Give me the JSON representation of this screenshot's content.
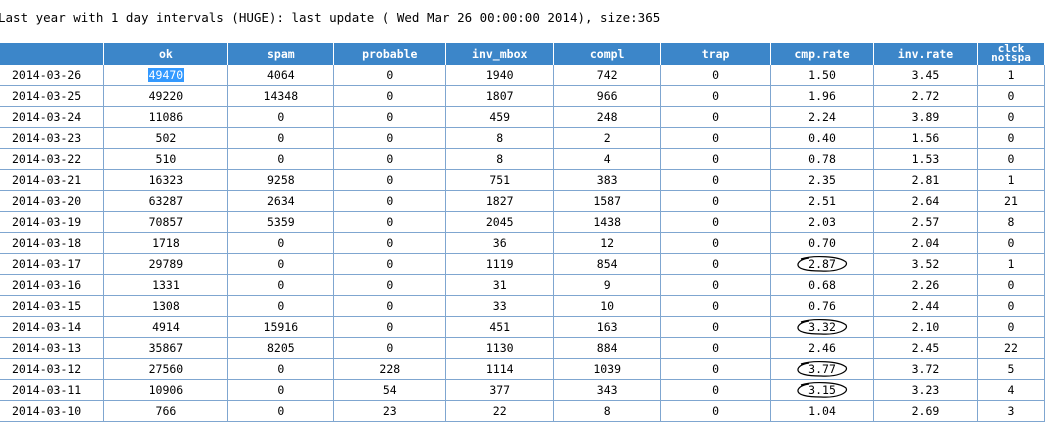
{
  "page": {
    "title": "Last year with 1 day intervals (HUGE): last update ( Wed Mar 26 00:00:00 2014), size:365"
  },
  "table": {
    "columns": [
      {
        "key": "date",
        "label": ""
      },
      {
        "key": "ok",
        "label": "ok"
      },
      {
        "key": "spam",
        "label": "spam"
      },
      {
        "key": "probable",
        "label": "probable"
      },
      {
        "key": "inv_mbox",
        "label": "inv_mbox"
      },
      {
        "key": "compl",
        "label": "compl"
      },
      {
        "key": "trap",
        "label": "trap"
      },
      {
        "key": "cmp_rate",
        "label": "cmp.rate"
      },
      {
        "key": "inv_rate",
        "label": "inv.rate"
      },
      {
        "key": "clck",
        "label_line1": "clck",
        "label_line2": "notspa"
      }
    ],
    "rows": [
      {
        "date": "2014-03-26",
        "ok": "49470",
        "spam": "4064",
        "probable": "0",
        "inv_mbox": "1940",
        "compl": "742",
        "trap": "0",
        "cmp_rate": "1.50",
        "inv_rate": "3.45",
        "clck": "1"
      },
      {
        "date": "2014-03-25",
        "ok": "49220",
        "spam": "14348",
        "probable": "0",
        "inv_mbox": "1807",
        "compl": "966",
        "trap": "0",
        "cmp_rate": "1.96",
        "inv_rate": "2.72",
        "clck": "0"
      },
      {
        "date": "2014-03-24",
        "ok": "11086",
        "spam": "0",
        "probable": "0",
        "inv_mbox": "459",
        "compl": "248",
        "trap": "0",
        "cmp_rate": "2.24",
        "inv_rate": "3.89",
        "clck": "0"
      },
      {
        "date": "2014-03-23",
        "ok": "502",
        "spam": "0",
        "probable": "0",
        "inv_mbox": "8",
        "compl": "2",
        "trap": "0",
        "cmp_rate": "0.40",
        "inv_rate": "1.56",
        "clck": "0"
      },
      {
        "date": "2014-03-22",
        "ok": "510",
        "spam": "0",
        "probable": "0",
        "inv_mbox": "8",
        "compl": "4",
        "trap": "0",
        "cmp_rate": "0.78",
        "inv_rate": "1.53",
        "clck": "0"
      },
      {
        "date": "2014-03-21",
        "ok": "16323",
        "spam": "9258",
        "probable": "0",
        "inv_mbox": "751",
        "compl": "383",
        "trap": "0",
        "cmp_rate": "2.35",
        "inv_rate": "2.81",
        "clck": "1"
      },
      {
        "date": "2014-03-20",
        "ok": "63287",
        "spam": "2634",
        "probable": "0",
        "inv_mbox": "1827",
        "compl": "1587",
        "trap": "0",
        "cmp_rate": "2.51",
        "inv_rate": "2.64",
        "clck": "21"
      },
      {
        "date": "2014-03-19",
        "ok": "70857",
        "spam": "5359",
        "probable": "0",
        "inv_mbox": "2045",
        "compl": "1438",
        "trap": "0",
        "cmp_rate": "2.03",
        "inv_rate": "2.57",
        "clck": "8"
      },
      {
        "date": "2014-03-18",
        "ok": "1718",
        "spam": "0",
        "probable": "0",
        "inv_mbox": "36",
        "compl": "12",
        "trap": "0",
        "cmp_rate": "0.70",
        "inv_rate": "2.04",
        "clck": "0"
      },
      {
        "date": "2014-03-17",
        "ok": "29789",
        "spam": "0",
        "probable": "0",
        "inv_mbox": "1119",
        "compl": "854",
        "trap": "0",
        "cmp_rate": "2.87",
        "inv_rate": "3.52",
        "clck": "1"
      },
      {
        "date": "2014-03-16",
        "ok": "1331",
        "spam": "0",
        "probable": "0",
        "inv_mbox": "31",
        "compl": "9",
        "trap": "0",
        "cmp_rate": "0.68",
        "inv_rate": "2.26",
        "clck": "0"
      },
      {
        "date": "2014-03-15",
        "ok": "1308",
        "spam": "0",
        "probable": "0",
        "inv_mbox": "33",
        "compl": "10",
        "trap": "0",
        "cmp_rate": "0.76",
        "inv_rate": "2.44",
        "clck": "0"
      },
      {
        "date": "2014-03-14",
        "ok": "4914",
        "spam": "15916",
        "probable": "0",
        "inv_mbox": "451",
        "compl": "163",
        "trap": "0",
        "cmp_rate": "3.32",
        "inv_rate": "2.10",
        "clck": "0"
      },
      {
        "date": "2014-03-13",
        "ok": "35867",
        "spam": "8205",
        "probable": "0",
        "inv_mbox": "1130",
        "compl": "884",
        "trap": "0",
        "cmp_rate": "2.46",
        "inv_rate": "2.45",
        "clck": "22"
      },
      {
        "date": "2014-03-12",
        "ok": "27560",
        "spam": "0",
        "probable": "228",
        "inv_mbox": "1114",
        "compl": "1039",
        "trap": "0",
        "cmp_rate": "3.77",
        "inv_rate": "3.72",
        "clck": "5"
      },
      {
        "date": "2014-03-11",
        "ok": "10906",
        "spam": "0",
        "probable": "54",
        "inv_mbox": "377",
        "compl": "343",
        "trap": "0",
        "cmp_rate": "3.15",
        "inv_rate": "3.23",
        "clck": "4"
      },
      {
        "date": "2014-03-10",
        "ok": "766",
        "spam": "0",
        "probable": "23",
        "inv_mbox": "22",
        "compl": "8",
        "trap": "0",
        "cmp_rate": "1.04",
        "inv_rate": "2.69",
        "clck": "3"
      }
    ],
    "selected_cell": {
      "row": 0,
      "column": "ok"
    },
    "circled_rows": [
      9,
      12,
      14,
      15
    ],
    "colors": {
      "header_bg": "#3c86c9",
      "header_text": "#ffffff",
      "grid_line": "#7fa6d0",
      "selection_bg": "#3399ff",
      "annotation_stroke": "#000000"
    }
  }
}
